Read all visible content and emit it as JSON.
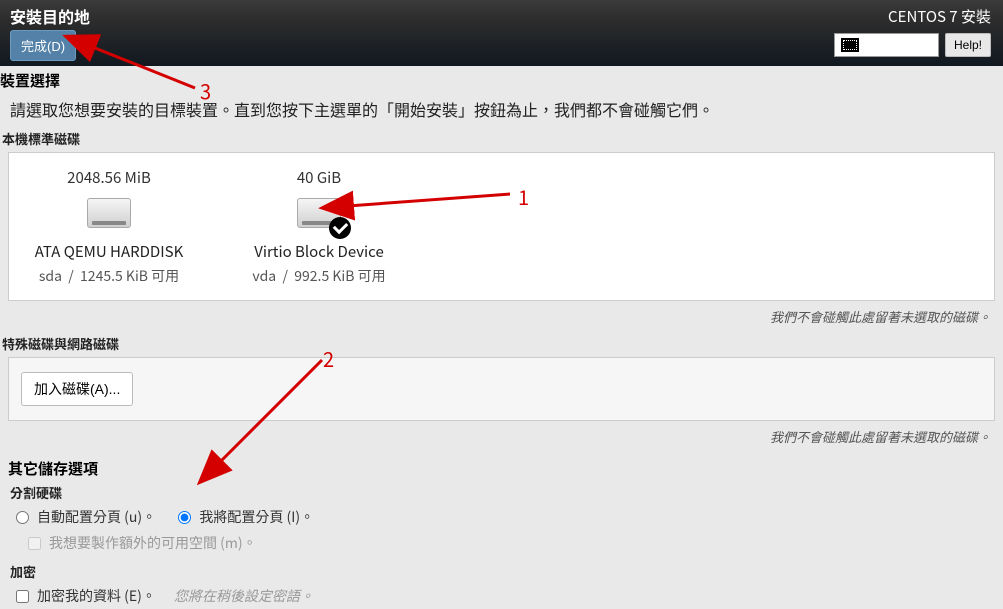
{
  "topbar": {
    "title": "安裝目的地",
    "done_label": "完成(D)"
  },
  "installer": {
    "name": "CENTOS 7 安裝",
    "lang": "cn",
    "help_label": "Help!"
  },
  "device_selection": {
    "heading": "裝置選擇",
    "desc": "請選取您想要安裝的目標裝置。直到您按下主選單的「開始安裝」按鈕為止，我們都不會碰觸它們。"
  },
  "local_disks": {
    "heading": "本機標準磁碟",
    "note": "我們不會碰觸此處留著未選取的磁碟。",
    "disks": [
      {
        "size": "2048.56 MiB",
        "name": "ATA QEMU HARDDISK",
        "dev": "sda",
        "free": "1245.5 KiB 可用",
        "selected": false
      },
      {
        "size": "40 GiB",
        "name": "Virtio Block Device",
        "dev": "vda",
        "free": "992.5 KiB 可用",
        "selected": true
      }
    ]
  },
  "special_disks": {
    "heading": "特殊磁碟與網路磁碟",
    "add_disk_label": "加入磁碟(A)...",
    "note": "我們不會碰觸此處留著未選取的磁碟。"
  },
  "other_options": {
    "heading": "其它儲存選項",
    "partitioning_heading": "分割硬碟",
    "auto_label": "自動配置分頁 (u)。",
    "manual_label": "我將配置分頁 (I)。",
    "partitioning_choice": "manual",
    "extra_space_label": "我想要製作額外的可用空間 (m)。",
    "extra_space_checked": false,
    "encrypt_heading": "加密",
    "encrypt_label": "加密我的資料 (E)。",
    "encrypt_checked": false,
    "encrypt_hint": "您將在稍後設定密語。"
  },
  "annotations": {
    "n1": "1",
    "n2": "2",
    "n3": "3"
  }
}
